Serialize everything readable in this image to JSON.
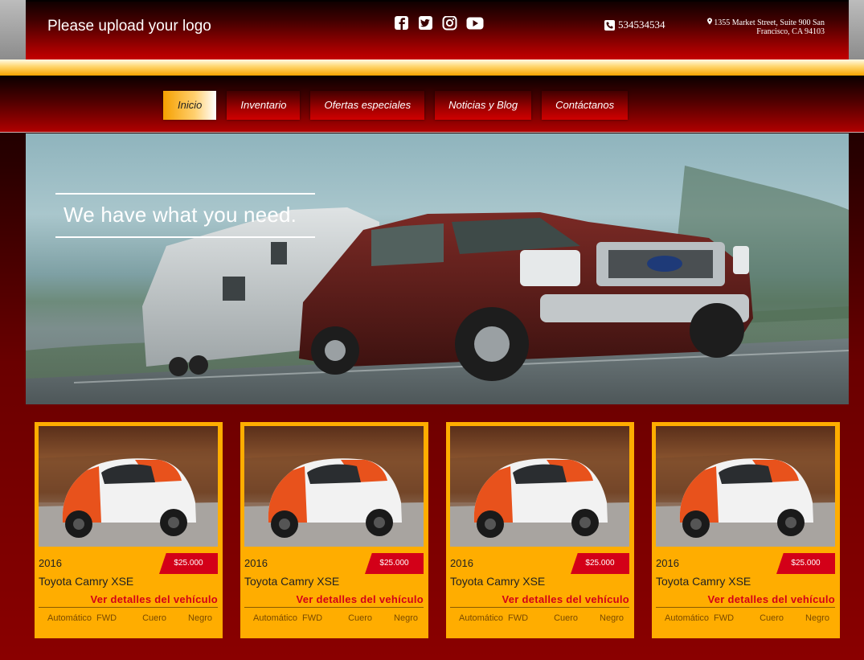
{
  "header": {
    "logo_text": "Please upload your logo",
    "social_icons": [
      "facebook-icon",
      "twitter-icon",
      "instagram-icon",
      "youtube-icon"
    ],
    "phone": "534534534",
    "address": "1355 Market Street, Suite 900 San Francisco, CA 94103"
  },
  "nav": {
    "items": [
      {
        "label": "Inicio",
        "active": true
      },
      {
        "label": "Inventario",
        "active": false
      },
      {
        "label": "Ofertas especiales",
        "active": false
      },
      {
        "label": "Noticias y Blog",
        "active": false
      },
      {
        "label": "Contáctanos",
        "active": false
      }
    ]
  },
  "hero": {
    "tagline": "We have what you need."
  },
  "cards": [
    {
      "year": "2016",
      "price": "$25.000",
      "model": "Toyota Camry XSE",
      "link": "Ver detalles del vehículo",
      "transmission": "Automático",
      "drive": "FWD",
      "interior": "Cuero",
      "color": "Negro"
    },
    {
      "year": "2016",
      "price": "$25.000",
      "model": "Toyota Camry XSE",
      "link": "Ver detalles del vehículo",
      "transmission": "Automático",
      "drive": "FWD",
      "interior": "Cuero",
      "color": "Negro"
    },
    {
      "year": "2016",
      "price": "$25.000",
      "model": "Toyota Camry XSE",
      "link": "Ver detalles del vehículo",
      "transmission": "Automático",
      "drive": "FWD",
      "interior": "Cuero",
      "color": "Negro"
    },
    {
      "year": "2016",
      "price": "$25.000",
      "model": "Toyota Camry XSE",
      "link": "Ver detalles del vehículo",
      "transmission": "Automático",
      "drive": "FWD",
      "interior": "Cuero",
      "color": "Negro"
    }
  ],
  "colors": {
    "accent_gold": "#ffad00",
    "price_red": "#d30018",
    "header_red": "#c40000"
  }
}
